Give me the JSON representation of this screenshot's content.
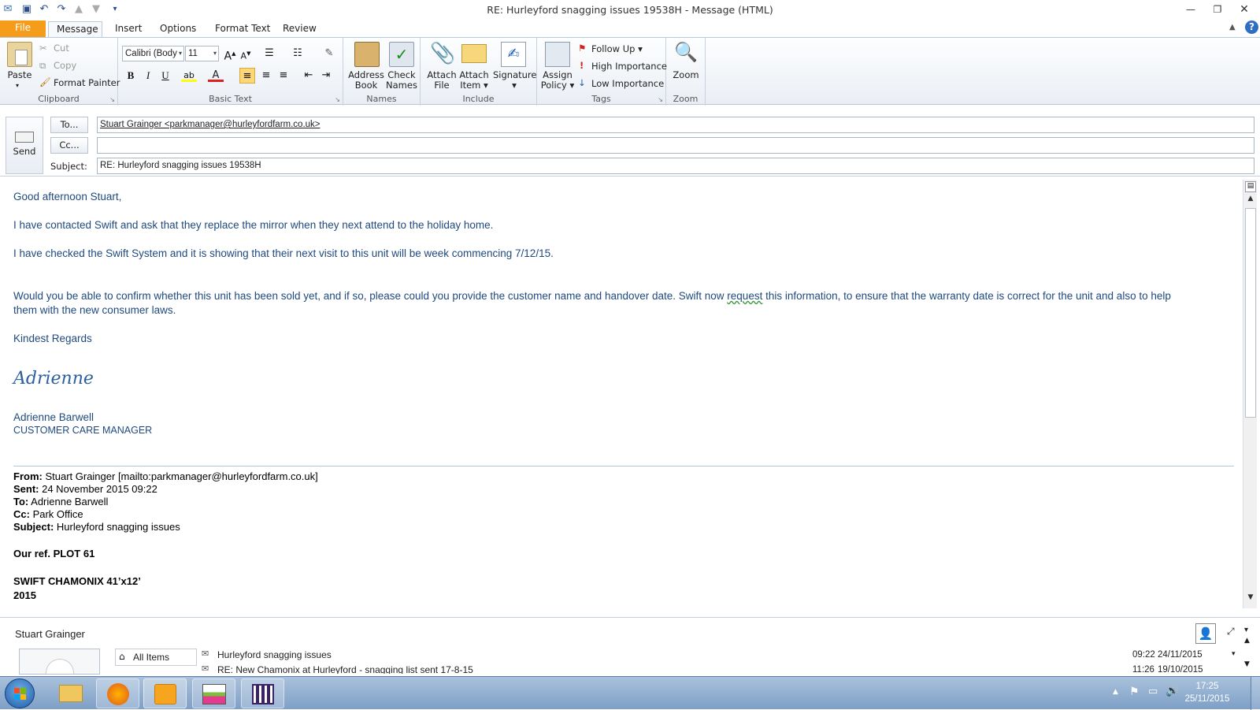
{
  "window": {
    "title": "RE: Hurleyford snagging issues 19538H - Message (HTML)"
  },
  "tabs": [
    "File",
    "Message",
    "Insert",
    "Options",
    "Format Text",
    "Review"
  ],
  "ribbon": {
    "clipboard": {
      "paste": "Paste",
      "cut": "Cut",
      "copy": "Copy",
      "format_painter": "Format Painter",
      "label": "Clipboard"
    },
    "basic_text": {
      "font": "Calibri (Body)",
      "size": "11",
      "label": "Basic Text"
    },
    "names": {
      "address_book": [
        "Address",
        "Book"
      ],
      "check_names": [
        "Check",
        "Names"
      ],
      "label": "Names"
    },
    "include": {
      "attach_file": [
        "Attach",
        "File"
      ],
      "attach_item": [
        "Attach",
        "Item"
      ],
      "signature": "Signature",
      "label": "Include"
    },
    "tags": {
      "assign_policy": [
        "Assign",
        "Policy"
      ],
      "follow_up": "Follow Up",
      "high_importance": "High Importance",
      "low_importance": "Low Importance",
      "label": "Tags"
    },
    "zoom": {
      "zoom": "Zoom",
      "label": "Zoom"
    }
  },
  "header": {
    "send": "Send",
    "to_button": "To...",
    "cc_button": "Cc...",
    "subject_label": "Subject:",
    "to_value": "Stuart Grainger <parkmanager@hurleyfordfarm.co.uk>",
    "cc_value": "",
    "subject_value": "RE: Hurleyford snagging issues 19538H"
  },
  "body": {
    "greeting": "Good afternoon Stuart,",
    "line1": "I have contacted Swift and ask that they replace the mirror when they next attend to the holiday home.",
    "line2": "I have checked the Swift System and it is showing that their next visit to this unit will be week commencing 7/12/15.",
    "line3a": "Would you be able to confirm whether this unit has been sold yet, and if so, please could you provide the customer name and handover date.  Swift now ",
    "line3_request": "request",
    "line3b": " this information, to ensure that the warranty date is correct for the unit and also to help",
    "line3c": "them with the new consumer laws.",
    "regards": "Kindest Regards",
    "signature": "Adrienne",
    "name": "Adrienne Barwell",
    "role": "CUSTOMER CARE MANAGER",
    "quoted": {
      "from_label": "From:",
      "from": " Stuart Grainger [mailto:parkmanager@hurleyfordfarm.co.uk]",
      "sent_label": "Sent:",
      "sent": " 24 November 2015 09:22",
      "to_label": "To:",
      "to": " Adrienne Barwell",
      "cc_label": "Cc:",
      "cc": " Park Office",
      "subject_label": "Subject:",
      "subject": " Hurleyford snagging issues",
      "ref": "Our ref. PLOT 61",
      "model": "SWIFT CHAMONIX 41’x12’",
      "year": "2015"
    }
  },
  "people_pane": {
    "name": "Stuart Grainger",
    "all_items": "All Items",
    "items": [
      {
        "subject": "Hurleyford snagging issues",
        "time": "09:22",
        "date": "24/11/2015"
      },
      {
        "subject": "RE: New Chamonix at Hurleyford - snagging list sent 17-8-15",
        "time": "11:26",
        "date": "19/10/2015"
      }
    ]
  },
  "taskbar": {
    "time": "17:25",
    "date": "25/11/2015"
  }
}
